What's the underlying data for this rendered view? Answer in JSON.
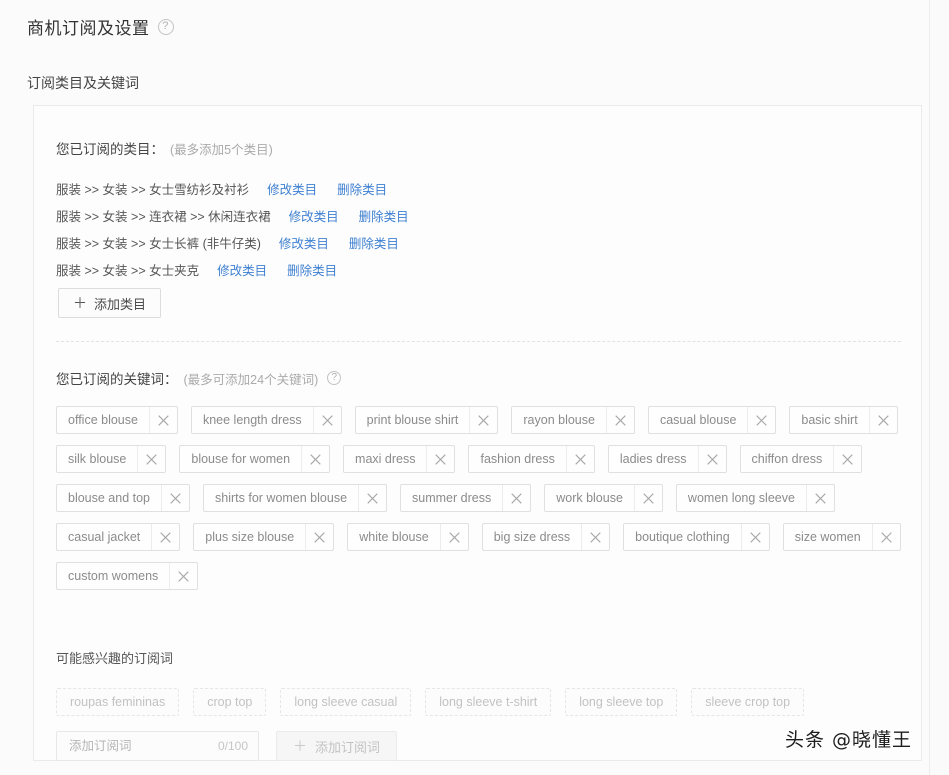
{
  "page": {
    "title": "商机订阅及设置",
    "help_icon": "?",
    "section_label": "订阅类目及关键词",
    "watermark": "头条 @晓懂王"
  },
  "categories": {
    "heading": "您已订阅的类目：",
    "hint": "(最多添加5个类目)",
    "edit_label": "修改类目",
    "delete_label": "删除类目",
    "items": [
      {
        "path": "服装 >> 女装 >> 女士雪纺衫及衬衫"
      },
      {
        "path": "服装 >> 女装 >> 连衣裙 >> 休闲连衣裙"
      },
      {
        "path": "服装 >> 女装 >> 女士长裤 (非牛仔类)"
      },
      {
        "path": "服装 >> 女装 >> 女士夹克"
      }
    ],
    "add_button": "添加类目",
    "add_icon": "plus-icon"
  },
  "keywords": {
    "heading": "您已订阅的关键词：",
    "hint": "(最多可添加24个关键词)",
    "help_icon": "?",
    "close_icon": "close-icon",
    "tags": [
      "office blouse",
      "knee length dress",
      "print blouse shirt",
      "rayon blouse",
      "casual blouse",
      "basic shirt",
      "silk blouse",
      "blouse for women",
      "maxi dress",
      "fashion dress",
      "ladies dress",
      "chiffon dress",
      "blouse and top",
      "shirts for women blouse",
      "summer dress",
      "work blouse",
      "women long sleeve",
      "casual jacket",
      "plus size blouse",
      "white blouse",
      "big size dress",
      "boutique clothing",
      "size women",
      "custom womens"
    ]
  },
  "suggestions": {
    "label": "可能感兴趣的订阅词",
    "chips": [
      "roupas femininas",
      "crop top",
      "long sleeve casual",
      "long sleeve t-shirt",
      "long sleeve top",
      "sleeve crop top"
    ]
  },
  "add_keyword": {
    "input_value": "",
    "placeholder": "添加订阅词",
    "counter": "0/100",
    "button_label": "添加订阅词",
    "button_icon": "plus-icon"
  },
  "colors": {
    "link": "#3d7fd0",
    "text": "#444444",
    "muted": "#aaaaaa",
    "tag_text": "#8b8b8b",
    "suggestion_text": "#c2c2c2"
  }
}
